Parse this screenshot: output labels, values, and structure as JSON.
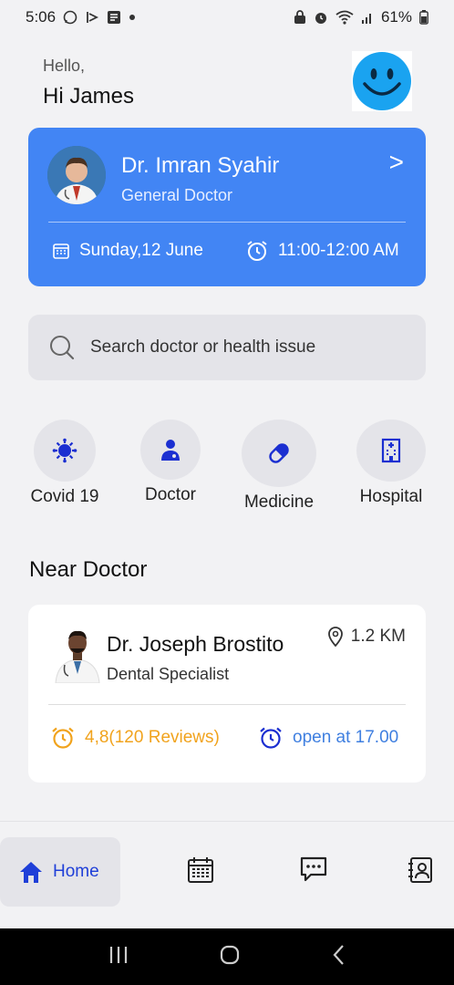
{
  "status_bar": {
    "time": "5:06",
    "battery": "61%"
  },
  "greeting": {
    "hello": "Hello,",
    "name": "Hi James"
  },
  "appointment": {
    "doctor_name": "Dr. Imran Syahir",
    "specialty": "General Doctor",
    "arrow": ">",
    "date": "Sunday,12 June",
    "time": "11:00-12:00 AM"
  },
  "search": {
    "placeholder": "Search doctor or health issue"
  },
  "categories": [
    {
      "label": "Covid 19",
      "icon": "virus-icon"
    },
    {
      "label": "Doctor",
      "icon": "doctor-icon"
    },
    {
      "label": "Medicine",
      "icon": "pill-icon"
    },
    {
      "label": "Hospital",
      "icon": "hospital-icon"
    }
  ],
  "near": {
    "title": "Near Doctor",
    "doctor_name": "Dr. Joseph Brostito",
    "specialty": "Dental Specialist",
    "distance": "1.2 KM",
    "rating": "4,8(120 Reviews)",
    "open": "open at 17.00"
  },
  "bottom_nav": {
    "home_label": "Home"
  },
  "colors": {
    "accent_blue": "#4285f4",
    "nav_blue": "#1f3fd8",
    "rating_orange": "#f1a31d",
    "open_blue": "#3f7fe0"
  }
}
